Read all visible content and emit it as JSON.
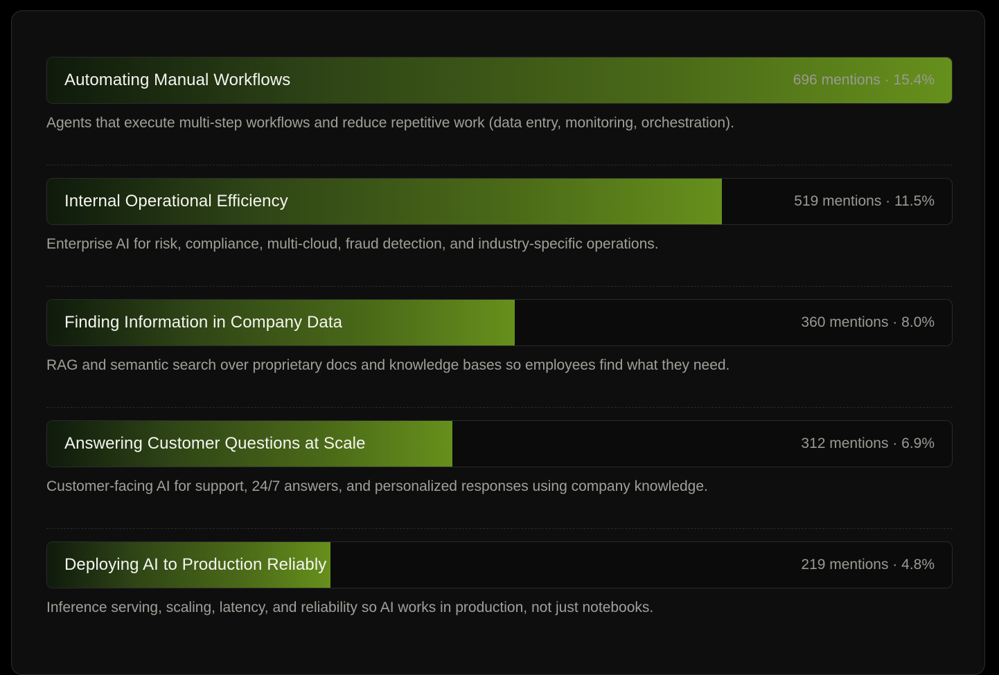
{
  "theme": {
    "accent": "#66901c",
    "background": "#0e0e0e"
  },
  "categories": [
    {
      "title": "Automating Manual Workflows",
      "stat": "696 mentions · 15.4%",
      "mentions": 696,
      "percent": 15.4,
      "relative_fill": 1.0,
      "description": "Agents that execute multi-step workflows and reduce repetitive work (data entry, monitoring, orchestration)."
    },
    {
      "title": "Internal Operational Efficiency",
      "stat": "519 mentions · 11.5%",
      "mentions": 519,
      "percent": 11.5,
      "relative_fill": 0.746,
      "description": "Enterprise AI for risk, compliance, multi-cloud, fraud detection, and industry-specific operations."
    },
    {
      "title": "Finding Information in Company Data",
      "stat": "360 mentions · 8.0%",
      "mentions": 360,
      "percent": 8.0,
      "relative_fill": 0.517,
      "description": "RAG and semantic search over proprietary docs and knowledge bases so employees find what they need."
    },
    {
      "title": "Answering Customer Questions at Scale",
      "stat": "312 mentions · 6.9%",
      "mentions": 312,
      "percent": 6.9,
      "relative_fill": 0.448,
      "description": "Customer-facing AI for support, 24/7 answers, and personalized responses using company knowledge."
    },
    {
      "title": "Deploying AI to Production Reliably",
      "stat": "219 mentions · 4.8%",
      "mentions": 219,
      "percent": 4.8,
      "relative_fill": 0.313,
      "description": "Inference serving, scaling, latency, and reliability so AI works in production, not just notebooks."
    }
  ]
}
